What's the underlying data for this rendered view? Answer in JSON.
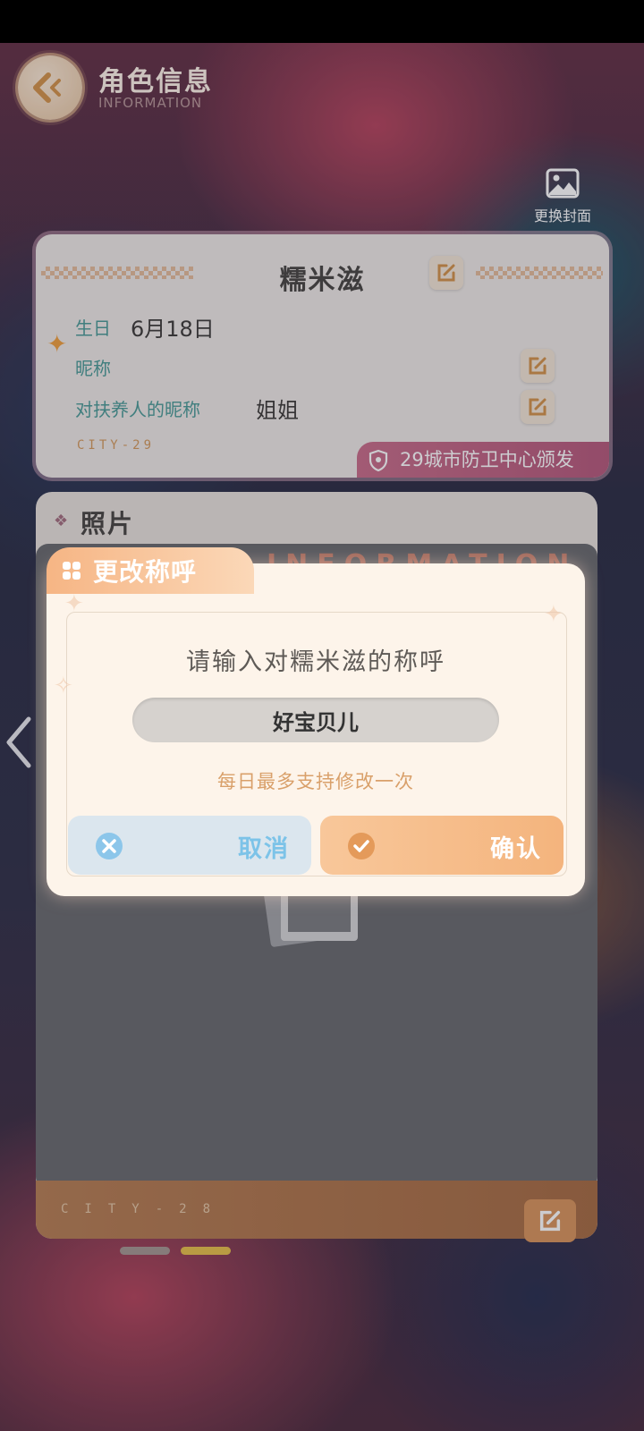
{
  "header": {
    "title": "角色信息",
    "subtitle": "INFORMATION"
  },
  "cover_button": {
    "label": "更换封面"
  },
  "character_card": {
    "name": "糯米滋",
    "birthday_label": "生日",
    "birthday_value": "6月18日",
    "nickname_label": "昵称",
    "nickname_value": "",
    "guardian_nickname_label": "对扶养人的昵称",
    "guardian_nickname_value": "姐姐",
    "city_code": "CITY-29",
    "issuer": "29城市防卫中心颁发"
  },
  "photo_card": {
    "title": "照片",
    "watermark": "INFORMATION",
    "city_code": "CITY-28"
  },
  "pager": {
    "count": 2,
    "active_index": 1
  },
  "dialog": {
    "tab_title": "更改称呼",
    "prompt": "请输入对糯米滋的称呼",
    "input_value": "好宝贝儿",
    "hint": "每日最多支持修改一次",
    "cancel_label": "取消",
    "confirm_label": "确认"
  },
  "colors": {
    "accent_orange": "#f4b47d",
    "teal_label": "#4c9c98",
    "issuer_pink": "#b75b7d",
    "cancel_blue": "#7cc3e8"
  }
}
